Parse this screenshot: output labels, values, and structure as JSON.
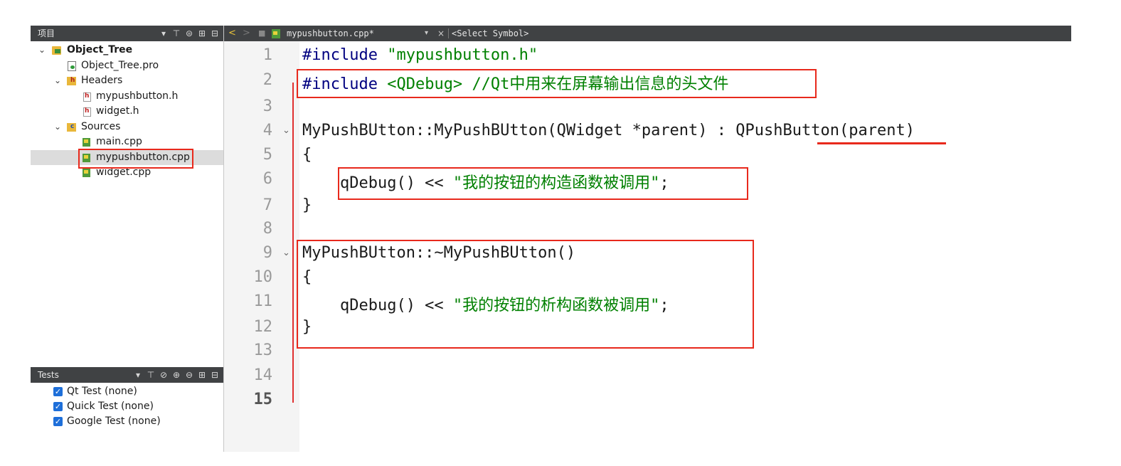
{
  "project_panel": {
    "title": "项目",
    "tools": [
      "▾",
      "⊤",
      "⊜",
      "⊞",
      "⊟"
    ]
  },
  "tree": {
    "root": "Object_Tree",
    "pro_file": "Object_Tree.pro",
    "headers_label": "Headers",
    "headers": [
      "mypushbutton.h",
      "widget.h"
    ],
    "sources_label": "Sources",
    "sources": [
      "main.cpp",
      "mypushbutton.cpp",
      "widget.cpp"
    ],
    "selected": "mypushbutton.cpp"
  },
  "tests_panel": {
    "title": "Tests",
    "tools": [
      "▾",
      "⊤",
      "⊘",
      "⊕",
      "⊖",
      "⊞",
      "⊟"
    ],
    "items": [
      "Qt Test (none)",
      "Quick Test (none)",
      "Google Test (none)"
    ]
  },
  "editor_bar": {
    "file_name": "mypushbutton.cpp*",
    "symbol": "<Select Symbol>",
    "back": "<",
    "forward": ">",
    "close": "×",
    "dropdown": "▾"
  },
  "editor": {
    "line_numbers": [
      "1",
      "2",
      "3",
      "4",
      "5",
      "6",
      "7",
      "8",
      "9",
      "10",
      "11",
      "12",
      "13",
      "14",
      "15"
    ],
    "current_line": "15",
    "fold_marker": "⌄",
    "lines": {
      "l1_directive": "#include",
      "l1_header": "\"mypushbutton.h\"",
      "l2_directive": "#include",
      "l2_header": "<QDebug>",
      "l2_comment": "//Qt中用来在屏幕输出信息的头文件",
      "l4_a": "MyPushBUtton::MyPushBUtton(QWidget *parent) : ",
      "l4_base": "QPushButton",
      "l4_b": "(parent)",
      "l5": "{",
      "l6_code": "    qDebug() << ",
      "l6_str": "\"我的按钮的构造函数被调用\"",
      "l6_end": ";",
      "l7": "}",
      "l9": "MyPushBUtton::~MyPushBUtton()",
      "l10": "{",
      "l11_code": "    qDebug() << ",
      "l11_str": "\"我的按钮的析构函数被调用\"",
      "l11_end": ";",
      "l12": "}"
    }
  },
  "colors": {
    "annotation": "#e8291c",
    "preprocessor": "#000080",
    "string": "#008000",
    "toolbar": "#404244"
  }
}
